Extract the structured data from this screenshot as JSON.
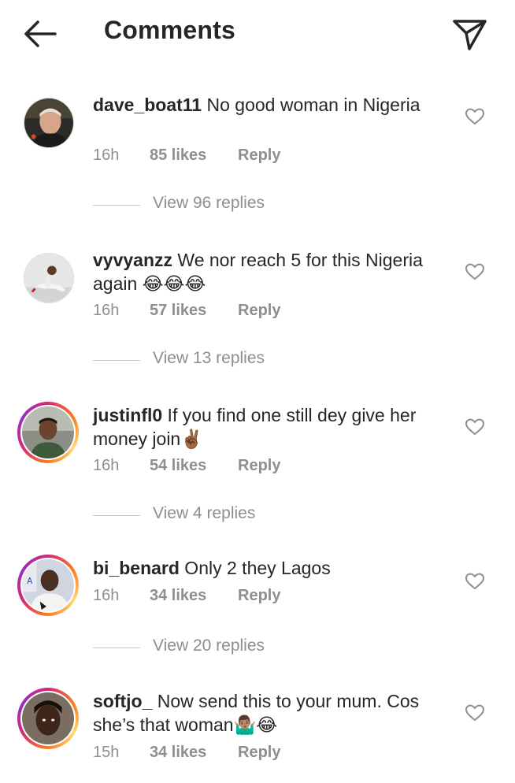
{
  "header": {
    "title": "Comments",
    "back_icon": "arrow-left-icon",
    "share_icon": "paper-plane-icon"
  },
  "comments": [
    {
      "username": "dave_boat11",
      "text": " No good woman in Nigeria",
      "time": "16h",
      "likes": "85 likes",
      "reply": "Reply",
      "view_replies": "View 96 replies",
      "avatar_ring": false
    },
    {
      "username": "vyvyanzz",
      "text": " We nor reach 5 for this Nigeria again 😂😂😂",
      "time": "16h",
      "likes": "57 likes",
      "reply": "Reply",
      "view_replies": "View 13 replies",
      "avatar_ring": false
    },
    {
      "username": "justinfl0",
      "text": " If you find one still dey give her money join✌🏾",
      "time": "16h",
      "likes": "54 likes",
      "reply": "Reply",
      "view_replies": "View 4 replies",
      "avatar_ring": true
    },
    {
      "username": "bi_benard",
      "text": " Only 2 they Lagos",
      "time": "16h",
      "likes": "34 likes",
      "reply": "Reply",
      "view_replies": "View 20 replies",
      "avatar_ring": true
    },
    {
      "username": "softjo_",
      "text": " Now send this to your mum. Cos she’s that woman🤷🏽‍♂️😂",
      "time": "15h",
      "likes": "34 likes",
      "reply": "Reply",
      "avatar_ring": true
    }
  ],
  "colors": {
    "text": "#262626",
    "secondary": "#8e8e8e",
    "ring_start": "#d62976",
    "ring_end": "#fa7e1e"
  }
}
